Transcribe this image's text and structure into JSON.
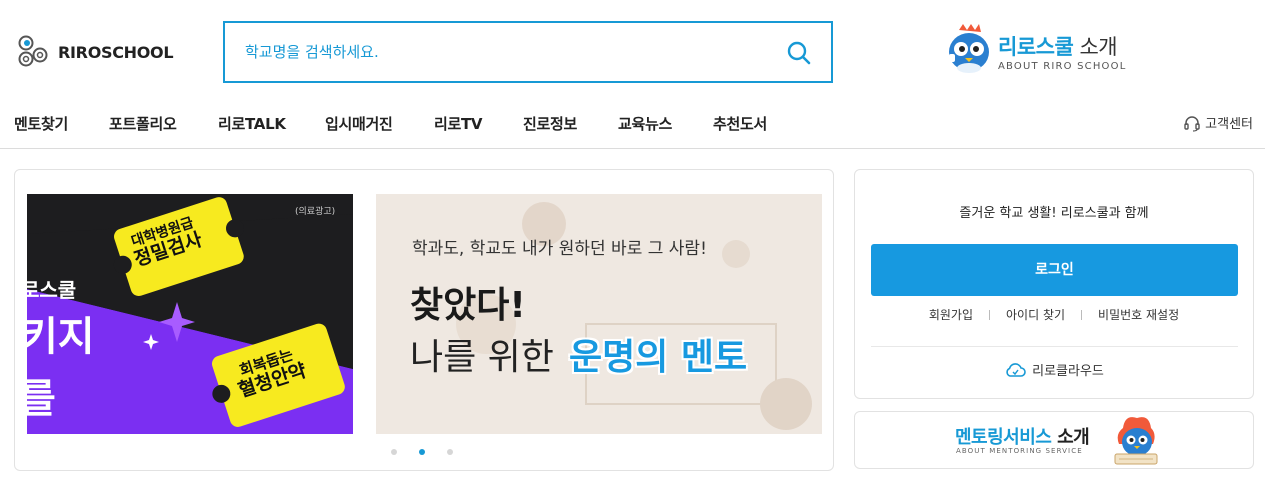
{
  "header": {
    "logo_text": "RIROSCHOOL",
    "search": {
      "placeholder": "학교명을 검색하세요."
    },
    "about": {
      "title_highlight": "리로스쿨",
      "title_rest": " 소개",
      "subtitle": "ABOUT RIRO SCHOOL"
    }
  },
  "nav": {
    "items": [
      {
        "label": "멘토찾기"
      },
      {
        "label": "포트폴리오"
      },
      {
        "label": "리로TALK"
      },
      {
        "label": "입시매거진"
      },
      {
        "label": "리로TV"
      },
      {
        "label": "진로정보"
      },
      {
        "label": "교육뉴스"
      },
      {
        "label": "추천도서"
      }
    ],
    "customer_center": "고객센터"
  },
  "banner": {
    "ad1": {
      "tag": "(의료광고)",
      "brand_partial": "로스쿨",
      "headline_partial_1": "키지",
      "headline_partial_2": "를",
      "ticket1_line1": "대학병원급",
      "ticket1_line2": "정밀검사",
      "ticket2_line1": "회복돕는",
      "ticket2_line2": "혈청안약"
    },
    "ad2": {
      "line1": "학과도, 학교도 내가 원하던 바로 그 사람!",
      "line2": "찾았다!",
      "line3_plain": "나를 위한",
      "line3_highlight": "운명의 멘토"
    },
    "active_slide": 2,
    "slide_count": 3
  },
  "login": {
    "message": "즐거운 학교 생활! 리로스쿨과 함께",
    "button": "로그인",
    "links": [
      "회원가입",
      "아이디 찾기",
      "비밀번호 재설정"
    ],
    "cloud_label": "리로클라우드"
  },
  "mentoring": {
    "title_highlight": "멘토링서비스",
    "title_rest": " 소개",
    "subtitle": "ABOUT MENTORING SERVICE"
  },
  "colors": {
    "accent": "#1799d5",
    "button": "#1799e0",
    "ad_purple": "#7b2ff2",
    "ad_yellow": "#f7ea1f"
  },
  "icons": [
    "riroschool-logo-icon",
    "search-icon",
    "mascot-icon",
    "headset-icon",
    "cloud-icon",
    "sparkle-icon"
  ]
}
